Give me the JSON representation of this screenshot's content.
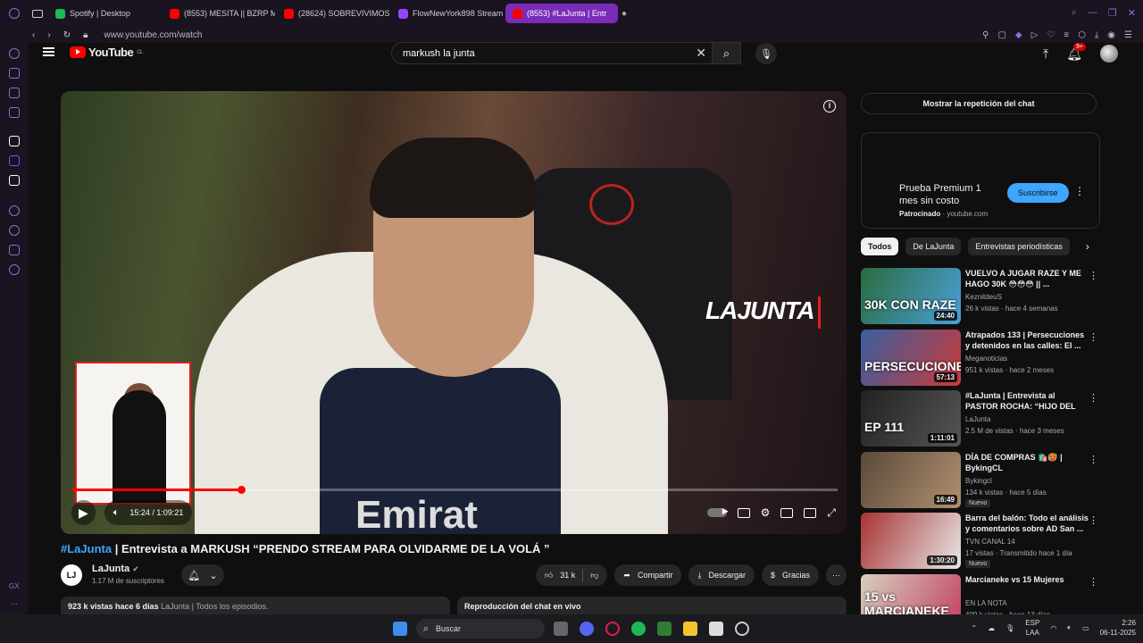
{
  "browser": {
    "tabs": [
      {
        "label": "Spotify | Desktop",
        "color": "#1db954"
      },
      {
        "label": "(8553) MESITA || BZRP M",
        "color": "#ff0000"
      },
      {
        "label": "(28624) SOBREVIVIMOS",
        "color": "#ff0000"
      },
      {
        "label": "FlowNewYork898 Stream",
        "color": "#9146ff"
      },
      {
        "label": "(8553) #LaJunta | Entr",
        "color": "#ff0000"
      }
    ],
    "url": "www.youtube.com/watch"
  },
  "youtube": {
    "logo_text": "YouTube",
    "logo_region": "CL",
    "search_value": "markush la junta",
    "notif_badge": "9+"
  },
  "player": {
    "watermark": "LAJUNTA",
    "current_time": "15:24",
    "duration": "1:09:21",
    "time_display": "15:24 / 1:09:21",
    "progress_fraction": 0.222,
    "shirt_text": "Emirat"
  },
  "video": {
    "title_tag": "#LaJunta",
    "title_rest": " | Entrevista a MARKUSH “PRENDO STREAM PARA OLVIDARME DE LA VOLÁ ”",
    "channel": "LaJunta",
    "subscribers": "1.17 M de suscriptores",
    "likes": "31 k",
    "share": "Compartir",
    "download": "Descargar",
    "thanks": "Gracias",
    "views": "923 k vistas  hace 6 días",
    "desc_link": "LaJunta | Todos los episodios.",
    "chat_replay_label": "Reproducción del chat en vivo"
  },
  "sidebar": {
    "chat_button": "Mostrar la repetición del chat",
    "ad": {
      "title": "Prueba Premium 1 mes sin costo",
      "sponsored": "Patrocinado",
      "domain": "youtube.com",
      "subscribe": "Suscribirse"
    },
    "chips": [
      "Todos",
      "De LaJunta",
      "Entrevistas periodísticas"
    ],
    "videos": [
      {
        "title": "VUELVO A JUGAR RAZE Y ME HAGO 30K 😳😳😳 || ...",
        "channel": "KeznitdeuS",
        "meta": "26 k vistas · hace 4 semanas",
        "duration": "24:40",
        "thumb_label": "30K CON RAZE",
        "thumb": "linear-gradient(120deg,#2a6b3f,#4aa0d8)",
        "nuevo": ""
      },
      {
        "title": "Atrapados 133 | Persecuciones y detenidos en las calles: El ...",
        "channel": "Meganoticias",
        "meta": "951 k vistas · hace 2 meses",
        "duration": "57:13",
        "thumb_label": "PERSECUCIONES",
        "thumb": "linear-gradient(120deg,#3a5fa0,#c93a3a)",
        "nuevo": ""
      },
      {
        "title": "#LaJunta | Entrevista al PASTOR ROCHA: “HIJO DEL J...",
        "channel": "LaJunta",
        "meta": "2.5 M de vistas · hace 3 meses",
        "duration": "1:11:01",
        "thumb_label": "EP 111",
        "thumb": "linear-gradient(120deg,#222,#555)",
        "nuevo": ""
      },
      {
        "title": "DÍA DE COMPRAS 🛍️🥵 | BykingCL",
        "channel": "Bykingcl",
        "meta": "134 k vistas · hace 5 días",
        "duration": "16:49",
        "thumb_label": "",
        "thumb": "linear-gradient(120deg,#5a4a3a,#b09070)",
        "nuevo": "Nuevo"
      },
      {
        "title": "Barra del balón:  Todo el análisis y comentarios sobre AD San ...",
        "channel": "TVN CANAL 14",
        "meta": "17 vistas · Transmitido hace 1 día",
        "duration": "1:30:20",
        "thumb_label": "",
        "thumb": "linear-gradient(120deg,#a83232,#e8e8e8)",
        "nuevo": "Nuevo"
      },
      {
        "title": "Marcianeke vs 15 Mujeres",
        "channel": "EN LA NOTA",
        "meta": "409 k vistas · hace 13 días",
        "duration": "",
        "thumb_label": "15 vs MARCIANEKE",
        "thumb": "linear-gradient(120deg,#d8d0c0,#c04060)",
        "nuevo": ""
      }
    ]
  },
  "taskbar": {
    "search_placeholder": "Buscar",
    "lang": "ESP",
    "lang2": "LAA",
    "time": "2:26",
    "date": "06-11-2025"
  }
}
